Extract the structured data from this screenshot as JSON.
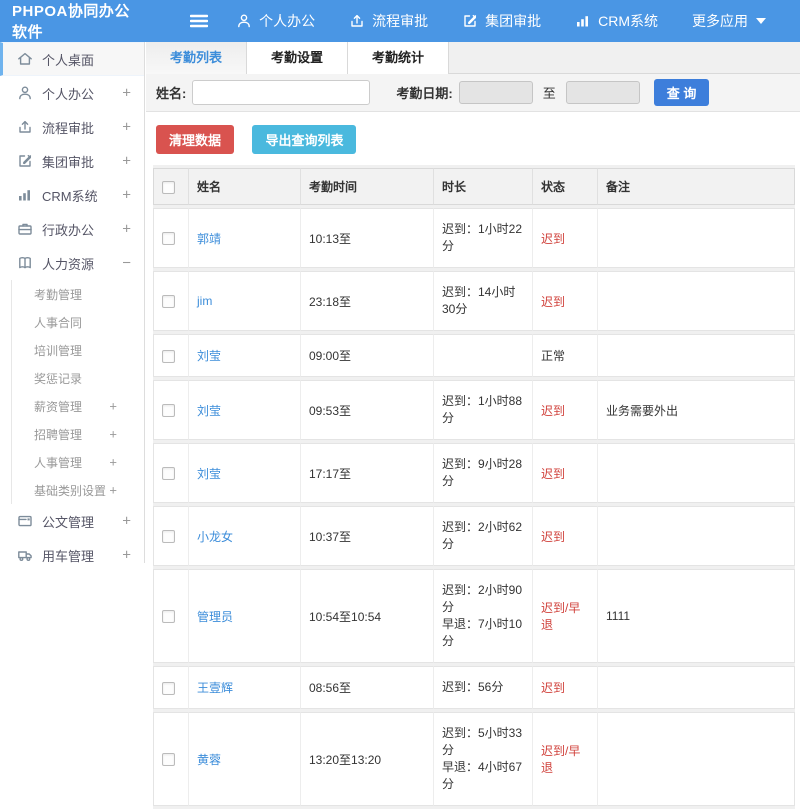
{
  "app": {
    "logo": "PHPOA协同办公软件"
  },
  "topnav": {
    "items": [
      {
        "label": "个人办公",
        "icon": "user"
      },
      {
        "label": "流程审批",
        "icon": "flow"
      },
      {
        "label": "集团审批",
        "icon": "edit"
      },
      {
        "label": "CRM系统",
        "icon": "chart"
      },
      {
        "label": "更多应用",
        "icon": "apps",
        "has_caret": true
      }
    ]
  },
  "sidebar": {
    "items": [
      {
        "label": "个人桌面",
        "icon": "home",
        "active": true
      },
      {
        "label": "个人办公",
        "icon": "user",
        "expand": "+"
      },
      {
        "label": "流程审批",
        "icon": "flow",
        "expand": "+"
      },
      {
        "label": "集团审批",
        "icon": "edit",
        "expand": "+"
      },
      {
        "label": "CRM系统",
        "icon": "chart",
        "expand": "+"
      },
      {
        "label": "行政办公",
        "icon": "briefcase",
        "expand": "+"
      },
      {
        "label": "人力资源",
        "icon": "book",
        "expand": "−",
        "children": [
          {
            "label": "考勤管理"
          },
          {
            "label": "人事合同"
          },
          {
            "label": "培训管理"
          },
          {
            "label": "奖惩记录"
          },
          {
            "label": "薪资管理",
            "expand": "+"
          },
          {
            "label": "招聘管理",
            "expand": "+"
          },
          {
            "label": "人事管理",
            "expand": "+"
          },
          {
            "label": "基础类别设置",
            "expand": "+"
          }
        ]
      },
      {
        "label": "公文管理",
        "icon": "doc",
        "expand": "+"
      },
      {
        "label": "用车管理",
        "icon": "car",
        "expand": "+"
      }
    ]
  },
  "tabs": {
    "items": [
      {
        "label": "考勤列表",
        "active": true
      },
      {
        "label": "考勤设置",
        "active": false
      },
      {
        "label": "考勤统计",
        "active": false
      }
    ]
  },
  "filter": {
    "name_label": "姓名:",
    "name_value": "",
    "date_label": "考勤日期:",
    "date_from": "",
    "to_label": "至",
    "date_to": "",
    "search_button": "查 询"
  },
  "toolbar": {
    "clean_button": "清理数据",
    "export_button": "导出查询列表"
  },
  "attendance_table": {
    "headers": [
      "姓名",
      "考勤时间",
      "时长",
      "状态",
      "备注"
    ],
    "rows": [
      {
        "name": "郭靖",
        "time": "10:13至",
        "duration": [
          "迟到：1小时22分"
        ],
        "status": "迟到",
        "status_type": "late",
        "note": ""
      },
      {
        "name": "jim",
        "time": "23:18至",
        "duration": [
          "迟到：14小时30分"
        ],
        "status": "迟到",
        "status_type": "late",
        "note": ""
      },
      {
        "name": "刘莹",
        "time": "09:00至",
        "duration": [],
        "status": "正常",
        "status_type": "normal",
        "note": ""
      },
      {
        "name": "刘莹",
        "time": "09:53至",
        "duration": [
          "迟到：1小时88分"
        ],
        "status": "迟到",
        "status_type": "late",
        "note": "业务需要外出"
      },
      {
        "name": "刘莹",
        "time": "17:17至",
        "duration": [
          "迟到：9小时28分"
        ],
        "status": "迟到",
        "status_type": "late",
        "note": ""
      },
      {
        "name": "小龙女",
        "time": "10:37至",
        "duration": [
          "迟到：2小时62分"
        ],
        "status": "迟到",
        "status_type": "late",
        "note": ""
      },
      {
        "name": "管理员",
        "time": "10:54至10:54",
        "duration": [
          "迟到：2小时90分",
          "早退：7小时10分"
        ],
        "status": "迟到/早退",
        "status_type": "late",
        "note": "1111"
      },
      {
        "name": "王壹辉",
        "time": "08:56至",
        "duration": [
          "迟到：56分"
        ],
        "status": "迟到",
        "status_type": "late",
        "note": ""
      },
      {
        "name": "黄蓉",
        "time": "13:20至13:20",
        "duration": [
          "迟到：5小时33分",
          "早退：4小时67分"
        ],
        "status": "迟到/早退",
        "status_type": "late",
        "note": ""
      }
    ]
  },
  "colors": {
    "topbar_blue": "#4a96e4",
    "search_blue": "#3d7edb",
    "link_blue": "#3c8dda",
    "danger_red": "#d9534f",
    "status_red": "#d0413b",
    "info_cyan": "#4ab9de",
    "sidebar_active_border": "#6fb3ee"
  }
}
